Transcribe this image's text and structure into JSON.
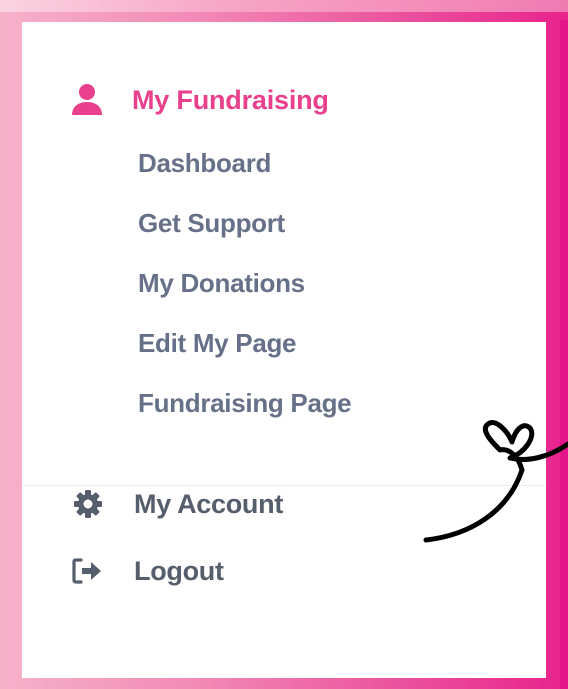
{
  "menu": {
    "heading": {
      "label": "My Fundraising",
      "icon": "user-icon"
    },
    "items": [
      {
        "label": "Dashboard"
      },
      {
        "label": "Get Support"
      },
      {
        "label": "My Donations"
      },
      {
        "label": "Edit My Page"
      },
      {
        "label": "Fundraising Page"
      }
    ],
    "account": {
      "label": "My Account",
      "icon": "gear-icon"
    },
    "logout": {
      "label": "Logout",
      "icon": "logout-icon"
    }
  },
  "colors": {
    "accent": "#e8408c",
    "sub_item_text": "#667189",
    "nav_text": "#555e6c",
    "frame_pink": "#e8238d"
  }
}
